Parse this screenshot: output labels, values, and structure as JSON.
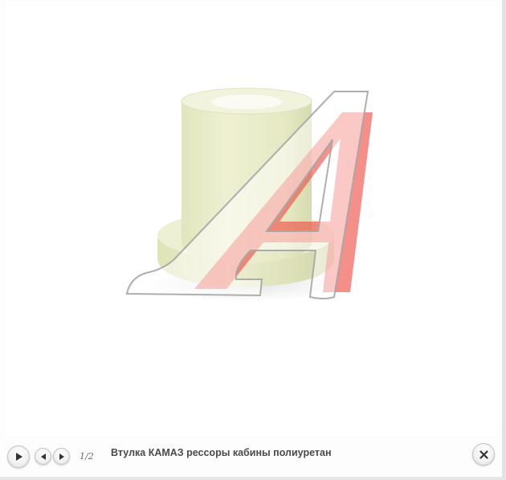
{
  "gallery": {
    "image_alt": "Втулка КАМАЗ рессоры кабины полиуретан",
    "counter": "1/2",
    "caption": "Втулка КАМАЗ рессоры кабины полиуретан",
    "controls": {
      "play_icon": "play-icon",
      "prev_icon": "triangle-left-icon",
      "next_icon": "triangle-right-icon",
      "close_icon": "close-x-icon"
    },
    "watermark": {
      "letter": "А",
      "colors": [
        "#e8453c",
        "#ffffff"
      ]
    },
    "colors": {
      "bushing": "#e9ecc9",
      "watermark_red": "#ee4a42",
      "caption": "#4a4a4a"
    }
  }
}
